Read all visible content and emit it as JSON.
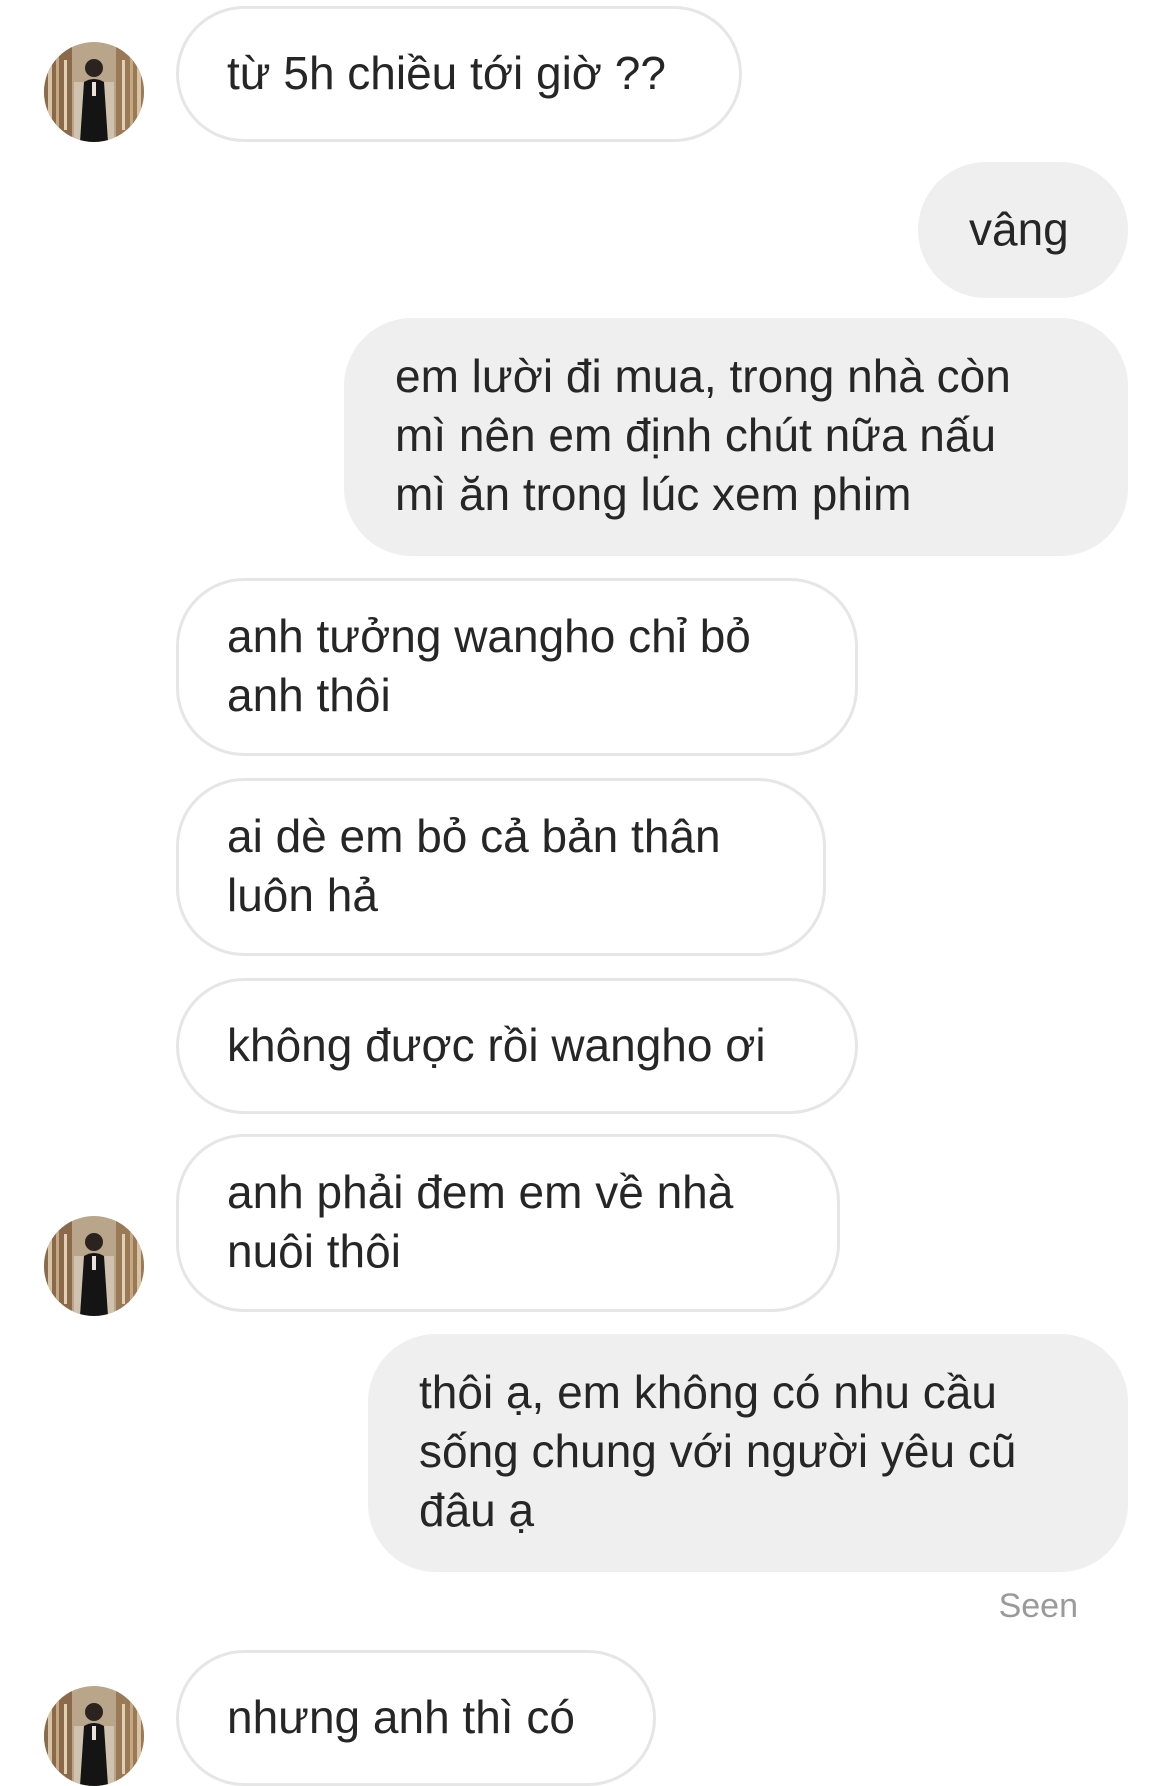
{
  "conversation": {
    "messages": [
      {
        "side": "incoming",
        "lines": [
          "từ 5h chiều tới giờ ??"
        ]
      },
      {
        "side": "outgoing",
        "lines": [
          "vâng"
        ]
      },
      {
        "side": "outgoing",
        "lines": [
          "em lười đi mua, trong nhà còn",
          "mì nên em định chút nữa nấu",
          "mì ăn trong lúc xem phim"
        ]
      },
      {
        "side": "incoming",
        "lines": [
          "anh tưởng wangho chỉ bỏ",
          "anh thôi"
        ]
      },
      {
        "side": "incoming",
        "lines": [
          "ai dè em bỏ cả bản thân",
          "luôn hả"
        ]
      },
      {
        "side": "incoming",
        "lines": [
          "không được rồi wangho ơi"
        ]
      },
      {
        "side": "incoming",
        "lines": [
          "anh phải đem em về nhà",
          "nuôi thôi"
        ]
      },
      {
        "side": "outgoing",
        "lines": [
          "thôi ạ, em không có nhu cầu",
          "sống chung với người yêu cũ",
          "đâu ạ"
        ]
      },
      {
        "side": "incoming",
        "lines": [
          "nhưng anh thì có"
        ]
      }
    ],
    "seen_label": "Seen"
  },
  "colors": {
    "outgoing_bubble": "#efefef",
    "incoming_border": "#e6e6e6",
    "text": "#262626",
    "seen_text": "#9a9a9a"
  },
  "icons": {
    "avatar": "contact-avatar-photo"
  }
}
